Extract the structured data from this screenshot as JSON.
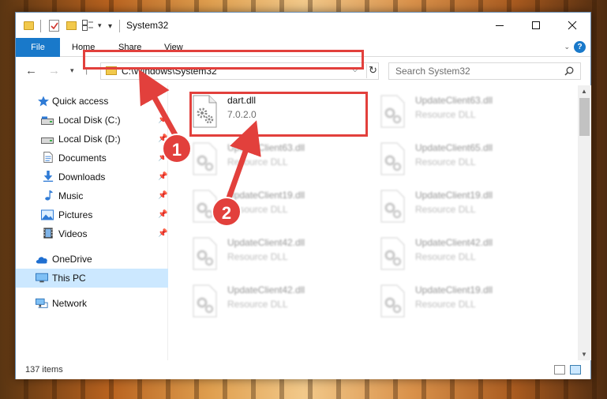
{
  "window": {
    "title": "System32"
  },
  "ribbon": {
    "tabs": [
      "File",
      "Home",
      "Share",
      "View"
    ],
    "collapse": "⌄",
    "help": "?"
  },
  "nav": {
    "address": "C:\\Windows\\System32",
    "search_placeholder": "Search System32"
  },
  "sidebar": {
    "items": [
      {
        "label": "Quick access",
        "icon": "star-icon",
        "pinned": false
      },
      {
        "label": "Local Disk (C:)",
        "icon": "drive-icon",
        "pinned": true
      },
      {
        "label": "Local Disk (D:)",
        "icon": "drive-icon",
        "pinned": true
      },
      {
        "label": "Documents",
        "icon": "documents-icon",
        "pinned": true
      },
      {
        "label": "Downloads",
        "icon": "downloads-icon",
        "pinned": true
      },
      {
        "label": "Music",
        "icon": "music-icon",
        "pinned": true
      },
      {
        "label": "Pictures",
        "icon": "pictures-icon",
        "pinned": true
      },
      {
        "label": "Videos",
        "icon": "videos-icon",
        "pinned": true
      },
      {
        "label": "OneDrive",
        "icon": "onedrive-icon",
        "pinned": false
      },
      {
        "label": "This PC",
        "icon": "pc-icon",
        "pinned": false,
        "selected": true
      },
      {
        "label": "Network",
        "icon": "network-icon",
        "pinned": false
      }
    ]
  },
  "files": [
    {
      "name": "dart.dll",
      "sub": "7.0.2.0"
    },
    {
      "name": "UpdateClient63.dll",
      "sub": "Resource DLL"
    },
    {
      "name": "UpdateClient63.dll",
      "sub": "Resource DLL"
    },
    {
      "name": "UpdateClient65.dll",
      "sub": "Resource DLL"
    },
    {
      "name": "UpdateClient19.dll",
      "sub": "Resource DLL"
    },
    {
      "name": "UpdateClient19.dll",
      "sub": "Resource DLL"
    },
    {
      "name": "UpdateClient42.dll",
      "sub": "Resource DLL"
    },
    {
      "name": "UpdateClient42.dll",
      "sub": "Resource DLL"
    },
    {
      "name": "UpdateClient42.dll",
      "sub": "Resource DLL"
    },
    {
      "name": "UpdateClient19.dll",
      "sub": "Resource DLL"
    }
  ],
  "status": {
    "count": "137 items"
  },
  "annotations": {
    "badge1": "1",
    "badge2": "2",
    "color": "#e2403c"
  }
}
